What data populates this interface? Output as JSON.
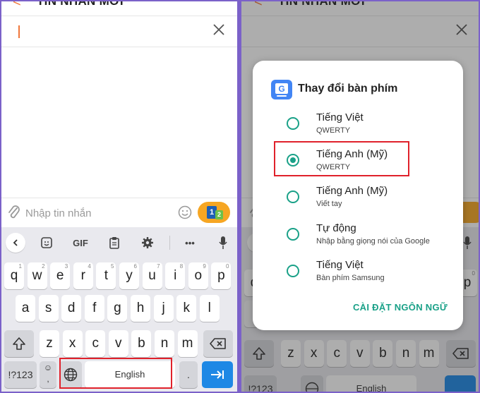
{
  "header": {
    "title": "TIN NHẮN MỚI",
    "back_glyph": "<"
  },
  "compose": {
    "placeholder": "Nhập tin nhắn",
    "sim_primary": "1",
    "sim_secondary": "2"
  },
  "toolbar": {
    "gif_label": "GIF",
    "more_label": "•••"
  },
  "keyboard": {
    "row1": [
      {
        "k": "q",
        "h": "1"
      },
      {
        "k": "w",
        "h": "2"
      },
      {
        "k": "e",
        "h": "3"
      },
      {
        "k": "r",
        "h": "4"
      },
      {
        "k": "t",
        "h": "5"
      },
      {
        "k": "y",
        "h": "6"
      },
      {
        "k": "u",
        "h": "7"
      },
      {
        "k": "i",
        "h": "8"
      },
      {
        "k": "o",
        "h": "9"
      },
      {
        "k": "p",
        "h": "0"
      }
    ],
    "row2": [
      "a",
      "s",
      "d",
      "f",
      "g",
      "h",
      "j",
      "k",
      "l"
    ],
    "row3": [
      "z",
      "x",
      "c",
      "v",
      "b",
      "n",
      "m"
    ],
    "symbols_label": "!#1",
    "symbols_label_display": "!?123",
    "space_label": "English",
    "period_label": ".",
    "comma_label": ","
  },
  "dialog": {
    "title": "Thay đổi bàn phím",
    "options": [
      {
        "label": "Tiếng Việt",
        "sub": "QWERTY",
        "selected": false
      },
      {
        "label": "Tiếng Anh (Mỹ)",
        "sub": "QWERTY",
        "selected": true
      },
      {
        "label": "Tiếng Anh (Mỹ)",
        "sub": "Viết tay",
        "selected": false
      },
      {
        "label": "Tự động",
        "sub": "Nhập bằng giọng nói của Google",
        "selected": false
      },
      {
        "label": "Tiếng Việt",
        "sub": "Bàn phím Samsung",
        "selected": false
      }
    ],
    "settings_link": "CÀI ĐẶT NGÔN NGỮ"
  },
  "colors": {
    "accent_orange": "#f0773a",
    "send_button": "#f6a623",
    "teal": "#1aa188",
    "enter_blue": "#1e88e5",
    "highlight_red": "#e0212b",
    "frame_purple": "#7b61c9"
  }
}
